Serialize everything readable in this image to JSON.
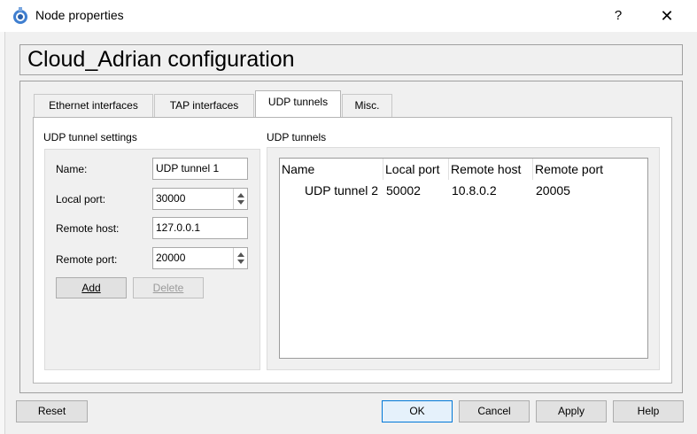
{
  "window": {
    "title": "Node properties",
    "help_label": "?",
    "close_label": "✕"
  },
  "heading": "Cloud_Adrian configuration",
  "tabs": [
    {
      "label": "Ethernet interfaces",
      "active": false
    },
    {
      "label": "TAP interfaces",
      "active": false
    },
    {
      "label": "UDP tunnels",
      "active": true
    },
    {
      "label": "Misc.",
      "active": false
    }
  ],
  "settings": {
    "title": "UDP tunnel settings",
    "name_label": "Name:",
    "name_value": "UDP tunnel 1",
    "local_port_label": "Local port:",
    "local_port_value": "30000",
    "remote_host_label": "Remote host:",
    "remote_host_value": "127.0.0.1",
    "remote_port_label": "Remote port:",
    "remote_port_value": "20000",
    "add_label": "Add",
    "delete_label": "Delete"
  },
  "tunnels": {
    "title": "UDP tunnels",
    "columns": [
      "Name",
      "Local port",
      "Remote host",
      "Remote port"
    ],
    "rows": [
      [
        "UDP tunnel 2",
        "50002",
        "10.8.0.2",
        "20005"
      ]
    ]
  },
  "footer": {
    "reset_label": "Reset",
    "ok_label": "OK",
    "cancel_label": "Cancel",
    "apply_label": "Apply",
    "help_label": "Help"
  },
  "colors": {
    "accent": "#0078d7",
    "window_bg": "#f0f0f0",
    "panel_bg": "#ffffff"
  }
}
